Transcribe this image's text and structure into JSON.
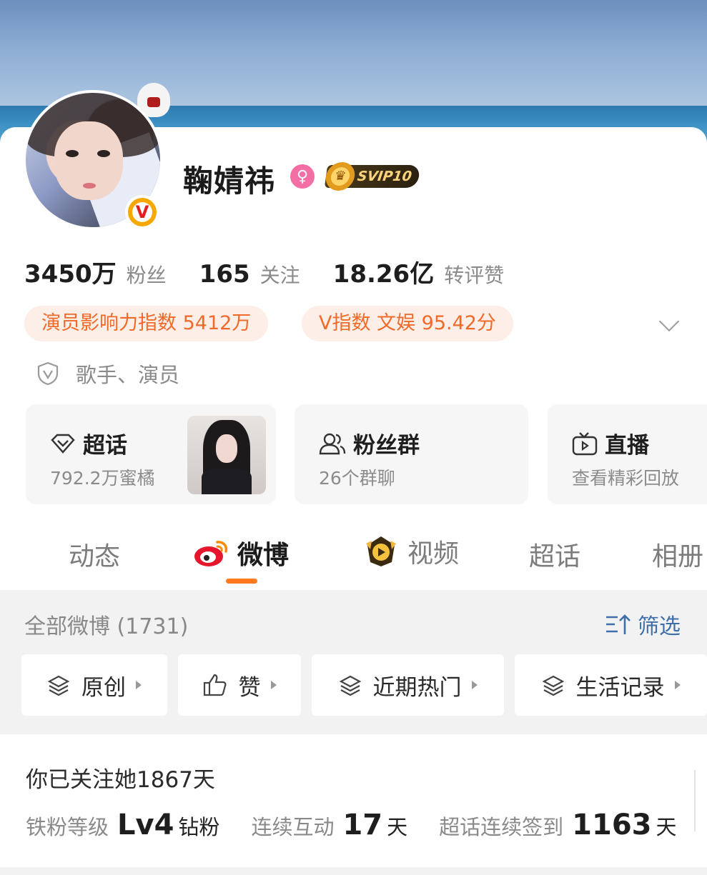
{
  "profile": {
    "name": "鞠婧祎",
    "svip_label": "SVIP10",
    "verified_label": "V"
  },
  "stats": [
    {
      "value": "3450万",
      "label": "粉丝"
    },
    {
      "value": "165",
      "label": "关注"
    },
    {
      "value": "18.26亿",
      "label": "转评赞"
    }
  ],
  "pills": [
    "演员影响力指数 5412万",
    "V指数 文娱 95.42分"
  ],
  "tags": "歌手、演员",
  "tiles": [
    {
      "title": "超话",
      "subtitle": "792.2万蜜橘"
    },
    {
      "title": "粉丝群",
      "subtitle": "26个群聊"
    },
    {
      "title": "直播",
      "subtitle": "查看精彩回放"
    }
  ],
  "tabs": [
    "动态",
    "微博",
    "视频",
    "超话",
    "相册"
  ],
  "active_tab": "微博",
  "feed": {
    "all_label": "全部微博 (1731)",
    "filter_label": "筛选",
    "chips": [
      "原创",
      "赞",
      "近期热门",
      "生活记录"
    ]
  },
  "follow": {
    "title": "你已关注她1867天",
    "fan_level_label": "铁粉等级",
    "fan_level_value": "Lv4",
    "fan_level_suffix": "钻粉",
    "interaction_label": "连续互动",
    "interaction_value": "17",
    "interaction_unit": "天",
    "checkin_label": "超话连续签到",
    "checkin_value": "1163",
    "checkin_unit": "天"
  },
  "colors": {
    "accent": "#ff7a1f",
    "pill_text": "#f06a2a",
    "pill_bg": "#fdeee7",
    "link_blue": "#3f6fa8",
    "gender_pink": "#f46ea6"
  },
  "icons": [
    "gender-female-icon",
    "crown-icon",
    "verified-v-icon",
    "shield-check-icon",
    "diamond-icon",
    "group-icon",
    "tv-icon",
    "weibo-logo-icon",
    "video-badge-icon",
    "filter-sort-icon",
    "layers-icon",
    "thumb-up-icon",
    "chevron-down-icon"
  ]
}
